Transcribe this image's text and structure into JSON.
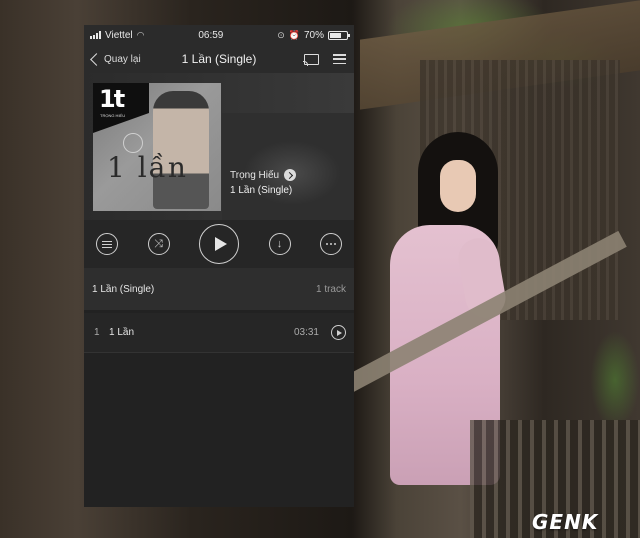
{
  "status": {
    "carrier": "Viettel",
    "time": "06:59",
    "battery": "70%",
    "battery_level": 0.7
  },
  "nav": {
    "back_label": "Quay lại",
    "title": "1 Lần (Single)"
  },
  "hero": {
    "cover_badge": "1t",
    "cover_sub": "TRỌNG HIẾU",
    "cover_text": "1 lần",
    "artist": "Trọng Hiếu",
    "album": "1 Lần (Single)"
  },
  "album_row": {
    "title": "1 Lần (Single)",
    "track_count": "1 track"
  },
  "tracks": [
    {
      "number": "1",
      "title": "1 Lần",
      "duration": "03:31"
    }
  ],
  "watermark": "GENK",
  "icons": [
    "back-chevron-icon",
    "cast-icon",
    "menu-icon",
    "queue-icon",
    "shuffle-icon",
    "play-icon",
    "download-icon",
    "more-icon",
    "chevron-right-icon"
  ]
}
